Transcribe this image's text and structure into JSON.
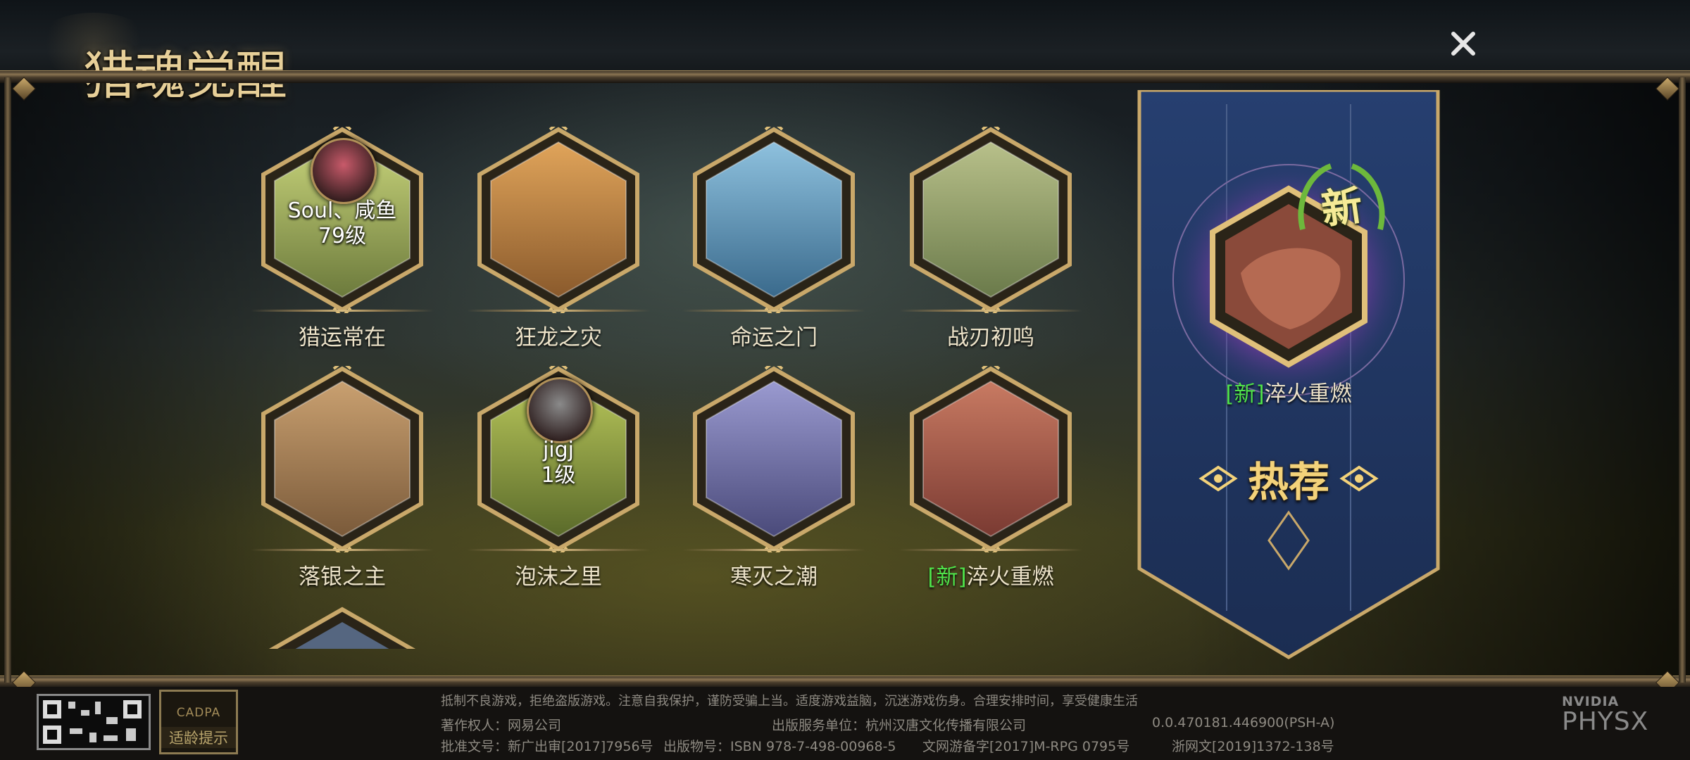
{
  "header": {
    "title": "猎魂觉醒",
    "close_icon": "close-icon"
  },
  "tiles": [
    {
      "label": "猎运常在",
      "player_name": "Soul、咸鱼",
      "player_level": "79级",
      "has_avatar": true,
      "avatar_color": "#c85a6a"
    },
    {
      "label": "狂龙之灾"
    },
    {
      "label": "命运之门"
    },
    {
      "label": "战刃初鸣"
    },
    {
      "label": "落银之主"
    },
    {
      "label": "泡沫之里",
      "player_name": "jigj",
      "player_level": "1级",
      "has_avatar": true,
      "avatar_color": "#8a8a8a"
    },
    {
      "label": "寒灭之潮"
    },
    {
      "new_tag": "[新]",
      "label": "淬火重燃"
    }
  ],
  "banner": {
    "badge": "新",
    "new_tag": "[新]",
    "title": "淬火重燃",
    "recommend": "热荐"
  },
  "footer": {
    "notice": "抵制不良游戏，拒绝盗版游戏。注意自我保护，谨防受骗上当。适度游戏益脑，沉迷游戏伤身。合理安排时间，享受健康生活",
    "copyright": "著作权人：网易公司",
    "publisher": "出版服务单位：杭州汉唐文化传播有限公司",
    "version": "0.0.470181.446900(PSH-A)",
    "approval": "批准文号：新广出审[2017]7956号",
    "isbn": "出版物号：ISBN 978-7-498-00968-5",
    "culture_record": "文网游备字[2017]M-RPG 0795号",
    "zhejiang": "浙网文[2019]1372-138号",
    "cadpa": "CADPA",
    "age_hint": "适龄提示",
    "nvidia": "NVIDIA",
    "physx": "PHYSX"
  },
  "colors": {
    "gold": "#d8bc80",
    "new_green": "#4fe24a",
    "banner_blue": "#1f3764"
  }
}
